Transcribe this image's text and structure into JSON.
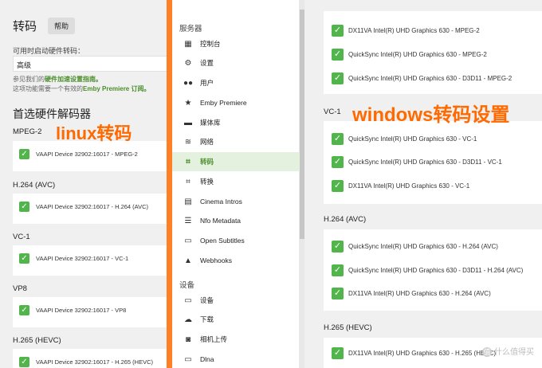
{
  "left": {
    "title": "转码",
    "help_label": "帮助",
    "hw_label": "可用时启动硬件转码：",
    "hw_value": "高级",
    "hint1_prefix": "参见我们的",
    "hint1_link": "硬件加速设置指南。",
    "hint2_prefix": "这项功能需要一个有效的",
    "hint2_link": "Emby Premiere 订阅。",
    "section_title": "首选硬件解码器",
    "annotation": "linux转码",
    "codecs": [
      {
        "name": "MPEG-2",
        "item": "VAAPI Device 32902:16017 - MPEG-2"
      },
      {
        "name": "H.264 (AVC)",
        "item": "VAAPI Device 32902:16017 - H.264 (AVC)"
      },
      {
        "name": "VC-1",
        "item": "VAAPI Device 32902:16017 - VC-1"
      },
      {
        "name": "VP8",
        "item": "VAAPI Device 32902:16017 - VP8"
      },
      {
        "name": "H.265 (HEVC)",
        "item": "VAAPI Device 32902:16017 - H.265 (HEVC)"
      }
    ]
  },
  "sidebar": {
    "server_header": "服务器",
    "devices_header": "设备",
    "items": [
      {
        "label": "控制台",
        "icon": "dashboard-icon",
        "glyph": "▦"
      },
      {
        "label": "设置",
        "icon": "gear-icon",
        "glyph": "⚙"
      },
      {
        "label": "用户",
        "icon": "people-icon",
        "glyph": "👥"
      },
      {
        "label": "Emby Premiere",
        "icon": "star-icon",
        "glyph": "★"
      },
      {
        "label": "媒体库",
        "icon": "folder-icon",
        "glyph": "▬"
      },
      {
        "label": "网络",
        "icon": "wifi-icon",
        "glyph": "≋"
      },
      {
        "label": "转码",
        "icon": "crop-icon",
        "glyph": "⌗",
        "active": true
      },
      {
        "label": "转换",
        "icon": "transform-icon",
        "glyph": "⌗"
      },
      {
        "label": "Cinema Intros",
        "icon": "movie-icon",
        "glyph": "▤"
      },
      {
        "label": "Nfo Metadata",
        "icon": "list-icon",
        "glyph": "☰"
      },
      {
        "label": "Open Subtitles",
        "icon": "subtitles-icon",
        "glyph": "▭"
      },
      {
        "label": "Webhooks",
        "icon": "bell-icon",
        "glyph": "🔔"
      }
    ],
    "device_items": [
      {
        "label": "设备",
        "icon": "devices-icon",
        "glyph": "▭"
      },
      {
        "label": "下载",
        "icon": "cloud-download-icon",
        "glyph": "☁"
      },
      {
        "label": "相机上传",
        "icon": "camera-icon",
        "glyph": "◙"
      },
      {
        "label": "Dlna",
        "icon": "cast-icon",
        "glyph": "▭"
      }
    ]
  },
  "right": {
    "annotation": "windows转码设置",
    "groups": [
      {
        "name": "",
        "items": [
          "DX11VA Intel(R) UHD Graphics 630 - MPEG-2",
          "QuickSync Intel(R) UHD Graphics 630 - MPEG-2",
          "QuickSync Intel(R) UHD Graphics 630 - D3D11 - MPEG-2"
        ]
      },
      {
        "name": "VC-1",
        "items": [
          "QuickSync Intel(R) UHD Graphics 630 - VC-1",
          "QuickSync Intel(R) UHD Graphics 630 - D3D11 - VC-1",
          "DX11VA Intel(R) UHD Graphics 630 - VC-1"
        ]
      },
      {
        "name": "H.264 (AVC)",
        "items": [
          "QuickSync Intel(R) UHD Graphics 630 - H.264 (AVC)",
          "QuickSync Intel(R) UHD Graphics 630 - D3D11 - H.264 (AVC)",
          "DX11VA Intel(R) UHD Graphics 630 - H.264 (AVC)"
        ]
      },
      {
        "name": "H.265 (HEVC)",
        "items": [
          "DX11VA Intel(R) UHD Graphics 630 - H.265 (HEVC)"
        ]
      }
    ]
  },
  "watermark": "什么值得买",
  "colors": {
    "accent": "#52b54b",
    "annotation": "#ff6a00",
    "divider": "#ff7f24",
    "active_bg": "#e4f1df"
  }
}
